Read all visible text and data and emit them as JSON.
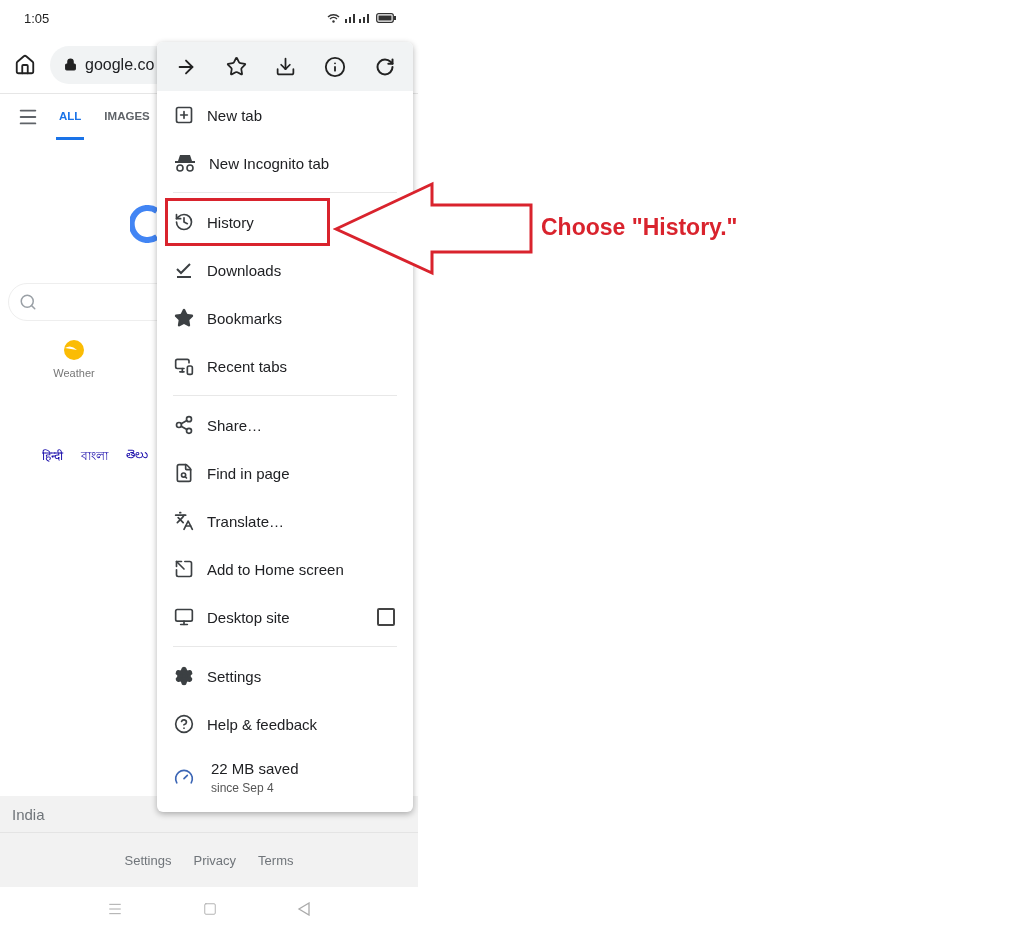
{
  "status_bar": {
    "time": "1:05"
  },
  "toolbar": {
    "url": "google.co"
  },
  "page": {
    "tabs": [
      {
        "label": "ALL",
        "selected": true
      },
      {
        "label": "IMAGES",
        "selected": false
      }
    ],
    "shortcuts": [
      {
        "label": "Weather"
      }
    ],
    "languages": [
      "हिन्दी",
      "বাংলা",
      "తెలు"
    ],
    "region": "India",
    "footer_links": [
      "Settings",
      "Privacy",
      "Terms"
    ]
  },
  "menu": {
    "items": [
      {
        "kind": "item",
        "label": "New tab",
        "highlighted": false
      },
      {
        "kind": "item",
        "label": "New Incognito tab",
        "highlighted": false
      },
      {
        "kind": "divider"
      },
      {
        "kind": "item",
        "label": "History",
        "highlighted": true
      },
      {
        "kind": "item",
        "label": "Downloads",
        "highlighted": false
      },
      {
        "kind": "item",
        "label": "Bookmarks",
        "highlighted": false
      },
      {
        "kind": "item",
        "label": "Recent tabs",
        "highlighted": false
      },
      {
        "kind": "divider"
      },
      {
        "kind": "item",
        "label": "Share…",
        "highlighted": false
      },
      {
        "kind": "item",
        "label": "Find in page",
        "highlighted": false
      },
      {
        "kind": "item",
        "label": "Translate…",
        "highlighted": false
      },
      {
        "kind": "item",
        "label": "Add to Home screen",
        "highlighted": false
      },
      {
        "kind": "checkbox",
        "label": "Desktop site",
        "checked": false,
        "highlighted": false
      },
      {
        "kind": "divider"
      },
      {
        "kind": "item",
        "label": "Settings",
        "highlighted": false
      },
      {
        "kind": "item",
        "label": "Help & feedback",
        "highlighted": false
      },
      {
        "kind": "saver",
        "label": "22 MB saved",
        "subtitle": "since Sep 4",
        "highlighted": false
      }
    ]
  },
  "annotation": {
    "text": "Choose \"History.\""
  }
}
